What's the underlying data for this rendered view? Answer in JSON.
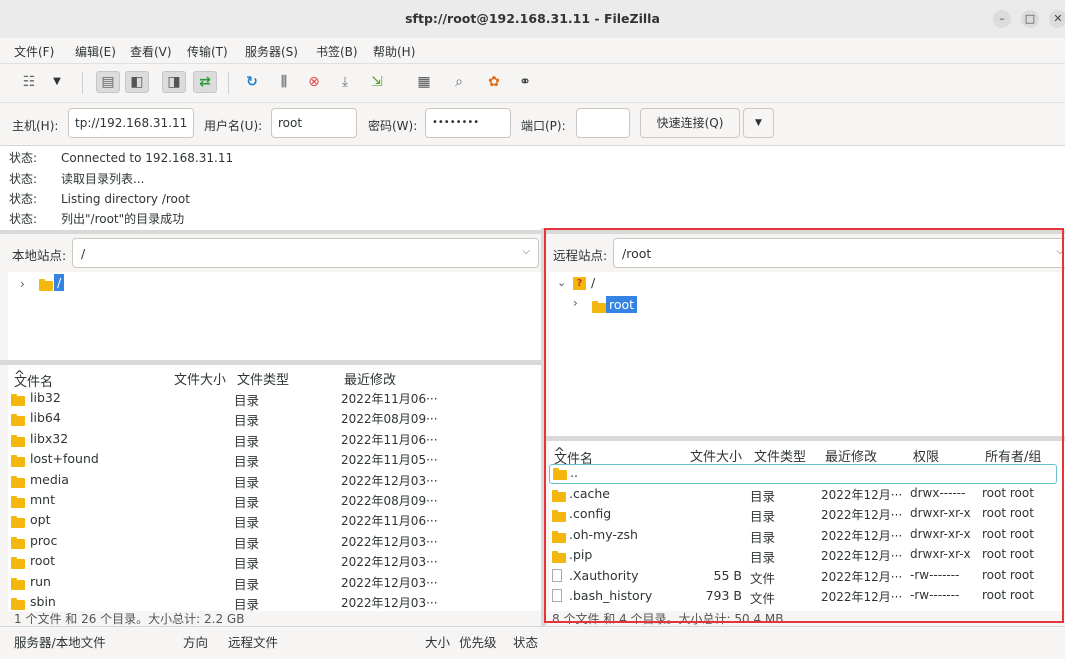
{
  "window": {
    "title": "sftp://root@192.168.31.11 - FileZilla"
  },
  "menu": [
    "文件(F)",
    "编辑(E)",
    "查看(V)",
    "传输(T)",
    "服务器(S)",
    "书签(B)",
    "帮助(H)"
  ],
  "quickconnect": {
    "host_label": "主机(H):",
    "host_value": "tp://192.168.31.11",
    "user_label": "用户名(U):",
    "user_value": "root",
    "pass_label": "密码(W):",
    "pass_value": "••••••••",
    "port_label": "端口(P):",
    "port_value": "",
    "connect_label": "快速连接(Q)"
  },
  "log": [
    {
      "k": "状态:",
      "v": "Connected to 192.168.31.11"
    },
    {
      "k": "状态:",
      "v": "读取目录列表..."
    },
    {
      "k": "状态:",
      "v": "Listing directory /root"
    },
    {
      "k": "状态:",
      "v": "列出\"/root\"的目录成功"
    }
  ],
  "local": {
    "site_label": "本地站点:",
    "site_path": "/",
    "tree_root": "/",
    "headers": {
      "name": "文件名",
      "size": "文件大小",
      "type": "文件类型",
      "modified": "最近修改"
    },
    "files": [
      {
        "name": "lib32",
        "type": "目录",
        "modified": "2022年11月06···"
      },
      {
        "name": "lib64",
        "type": "目录",
        "modified": "2022年08月09···"
      },
      {
        "name": "libx32",
        "type": "目录",
        "modified": "2022年11月06···"
      },
      {
        "name": "lost+found",
        "type": "目录",
        "modified": "2022年11月05···"
      },
      {
        "name": "media",
        "type": "目录",
        "modified": "2022年12月03···"
      },
      {
        "name": "mnt",
        "type": "目录",
        "modified": "2022年08月09···"
      },
      {
        "name": "opt",
        "type": "目录",
        "modified": "2022年11月06···"
      },
      {
        "name": "proc",
        "type": "目录",
        "modified": "2022年12月03···"
      },
      {
        "name": "root",
        "type": "目录",
        "modified": "2022年12月03···"
      },
      {
        "name": "run",
        "type": "目录",
        "modified": "2022年12月03···"
      },
      {
        "name": "sbin",
        "type": "目录",
        "modified": "2022年12月03···"
      }
    ],
    "status": "1 个文件 和 26 个目录。大小总计: 2.2 GB"
  },
  "remote": {
    "site_label": "远程站点:",
    "site_path": "/root",
    "tree_root": "/",
    "tree_child": "root",
    "headers": {
      "name": "文件名",
      "size": "文件大小",
      "type": "文件类型",
      "modified": "最近修改",
      "perm": "权限",
      "owner": "所有者/组"
    },
    "parent": "..",
    "files": [
      {
        "name": ".cache",
        "size": "",
        "type": "目录",
        "modified": "2022年12月···",
        "perm": "drwx------",
        "owner": "root root",
        "dir": true
      },
      {
        "name": ".config",
        "size": "",
        "type": "目录",
        "modified": "2022年12月···",
        "perm": "drwxr-xr-x",
        "owner": "root root",
        "dir": true
      },
      {
        "name": ".oh-my-zsh",
        "size": "",
        "type": "目录",
        "modified": "2022年12月···",
        "perm": "drwxr-xr-x",
        "owner": "root root",
        "dir": true
      },
      {
        "name": ".pip",
        "size": "",
        "type": "目录",
        "modified": "2022年12月···",
        "perm": "drwxr-xr-x",
        "owner": "root root",
        "dir": true
      },
      {
        "name": ".Xauthority",
        "size": "55 B",
        "type": "文件",
        "modified": "2022年12月···",
        "perm": "-rw-------",
        "owner": "root root",
        "dir": false
      },
      {
        "name": ".bash_history",
        "size": "793 B",
        "type": "文件",
        "modified": "2022年12月···",
        "perm": "-rw-------",
        "owner": "root root",
        "dir": false
      }
    ],
    "status": "8 个文件 和 4 个目录。大小总计: 50.4 MB"
  },
  "queue": {
    "server": "服务器/本地文件",
    "direction": "方向",
    "remote": "远程文件",
    "size": "大小",
    "priority": "优先级",
    "status": "状态"
  },
  "colors": {
    "highlight": "#e5343a",
    "folder": "#f4b70d",
    "selection": "#3584e4"
  }
}
